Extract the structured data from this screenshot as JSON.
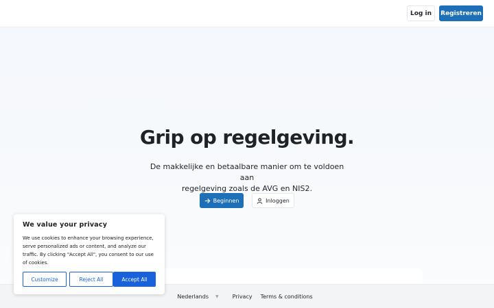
{
  "header": {
    "login_label": "Log in",
    "register_label": "Registreren"
  },
  "hero": {
    "title": "Grip op regelgeving.",
    "subtitle_line1": "De makkelijke en betaalbare manier om te voldoen aan",
    "subtitle_line2": "regelgeving zoals de AVG en NIS2.",
    "start_label": "Beginnen",
    "signin_label": "Inloggen"
  },
  "footer": {
    "language": "Nederlands",
    "privacy": "Privacy",
    "terms": "Terms & conditions"
  },
  "cookie": {
    "title": "We value your privacy",
    "text": "We use cookies to enhance your browsing experience, serve personalized ads or content, and analyze our traffic. By clicking \"Accept All\", you consent to our use of cookies.",
    "customize_label": "Customize",
    "reject_label": "Reject All",
    "accept_label": "Accept All"
  },
  "icons": {
    "start": "arrow-right-icon",
    "signin": "user-icon",
    "language": "chevron-down-icon"
  },
  "colors": {
    "primary": "#1d6fb8",
    "cookie_accent": "#1863dc"
  }
}
